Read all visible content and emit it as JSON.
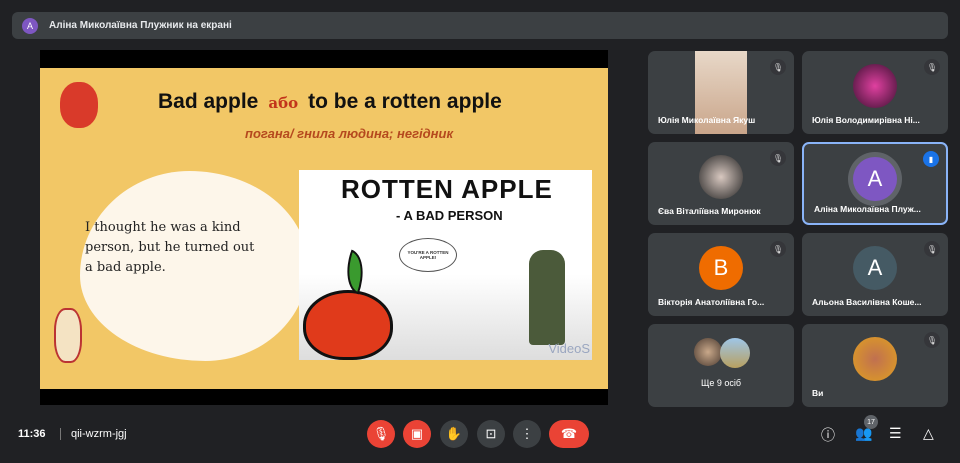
{
  "presenter_bar": {
    "avatar_letter": "А",
    "text": "Аліна Миколаївна Плужник на екрані"
  },
  "slide": {
    "title_en1": "Bad apple",
    "title_or": "або",
    "title_en2": "to be a rotten apple",
    "subtitle": "погана/ гнила людина; негідник",
    "example": "I thought he was a kind person, but he turned out a bad apple.",
    "video": {
      "title": "ROTTEN APPLE",
      "subtitle": "- A BAD PERSON",
      "bubble": "YOU'RE A ROTTEN APPLE!",
      "logo": "VideoS"
    }
  },
  "participants": [
    {
      "name": "Юлія Миколаївна Якуш",
      "muted": true
    },
    {
      "name": "Юлія Володимирівна Ні...",
      "muted": true
    },
    {
      "name": "Єва Віталіївна Миронюк",
      "muted": true
    },
    {
      "name": "Аліна Миколаївна Плуж...",
      "letter": "А",
      "speaking": true,
      "color": "#7e57c2"
    },
    {
      "name": "Вікторія Анатоліївна Го...",
      "letter": "В",
      "muted": true,
      "color": "#ef6c00"
    },
    {
      "name": "Альона Василівна Коше...",
      "letter": "А",
      "muted": true,
      "color": "#455a64"
    },
    {
      "name": "Ще 9 осіб"
    },
    {
      "name": "Ви",
      "muted": true
    }
  ],
  "bottom": {
    "time": "11:36",
    "meeting_code": "qii-wzrm-jgj",
    "participant_count": "17"
  }
}
